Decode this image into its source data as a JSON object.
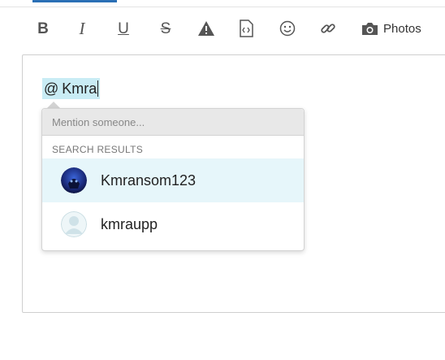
{
  "toolbar": {
    "bold": "B",
    "italic": "I",
    "underline": "U",
    "strikethrough": "S",
    "photos_label": "Photos",
    "icons": [
      "bold-icon",
      "italic-icon",
      "underline-icon",
      "strikethrough-icon",
      "warning-icon",
      "code-file-icon",
      "emoji-icon",
      "link-icon",
      "camera-icon"
    ]
  },
  "editor": {
    "mention_at": "@",
    "mention_query": "Kmra"
  },
  "mention_dropdown": {
    "placeholder": "Mention someone...",
    "results_header": "SEARCH RESULTS",
    "results": [
      {
        "name": "Kmransom123",
        "highlighted": true
      },
      {
        "name": "kmraupp",
        "highlighted": false
      }
    ]
  },
  "colors": {
    "accent": "#2a6fb5",
    "chip_bg": "#c9ecf5",
    "highlight_row": "#e6f6fa"
  }
}
